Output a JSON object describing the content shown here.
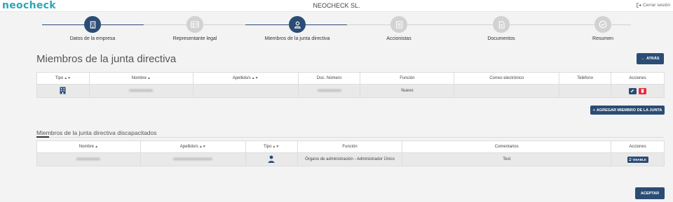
{
  "header": {
    "logo": "neocheck",
    "company": "NEOCHECK SL.",
    "logout": "Cerrar sesión"
  },
  "steps": [
    {
      "label": "Datos de la empresa",
      "icon": "building-icon",
      "state": "active"
    },
    {
      "label": "Representante legal",
      "icon": "id-card-icon",
      "state": "inactive"
    },
    {
      "label": "Miembros de la junta directiva",
      "icon": "user-icon",
      "state": "active"
    },
    {
      "label": "Accionistas",
      "icon": "list-icon",
      "state": "inactive"
    },
    {
      "label": "Documentos",
      "icon": "document-icon",
      "state": "inactive"
    },
    {
      "label": "Resumen",
      "icon": "check-icon",
      "state": "inactive"
    }
  ],
  "board": {
    "title": "Miembros de la junta directiva",
    "back_label": "ATRÁS",
    "columns": [
      "Tipo",
      "Nombre",
      "Apellido/s",
      "Doc. Número",
      "Función",
      "Correo electrónico",
      "Teléfono",
      "Acciones"
    ],
    "row": {
      "tipo_icon": "building-icon",
      "funcion": "Nuevo"
    },
    "add_label": "AGREGAR MIEMBRO DE LA JUNTA"
  },
  "disabled": {
    "title": "Miembros de la junta directiva discapacitados",
    "columns": [
      "Nombre",
      "Apellido/s",
      "Tipo",
      "Función",
      "Comentarios",
      "Acciones"
    ],
    "row": {
      "tipo_icon": "person-icon",
      "funcion": "Órgano de administración - Administrador Único",
      "comentarios": "Test",
      "enable_label": "ENABLE"
    }
  },
  "accept_label": "ACEPTAR",
  "colors": {
    "primary": "#2b4c74",
    "danger": "#e8283a",
    "logo": "#2aa6b6"
  }
}
